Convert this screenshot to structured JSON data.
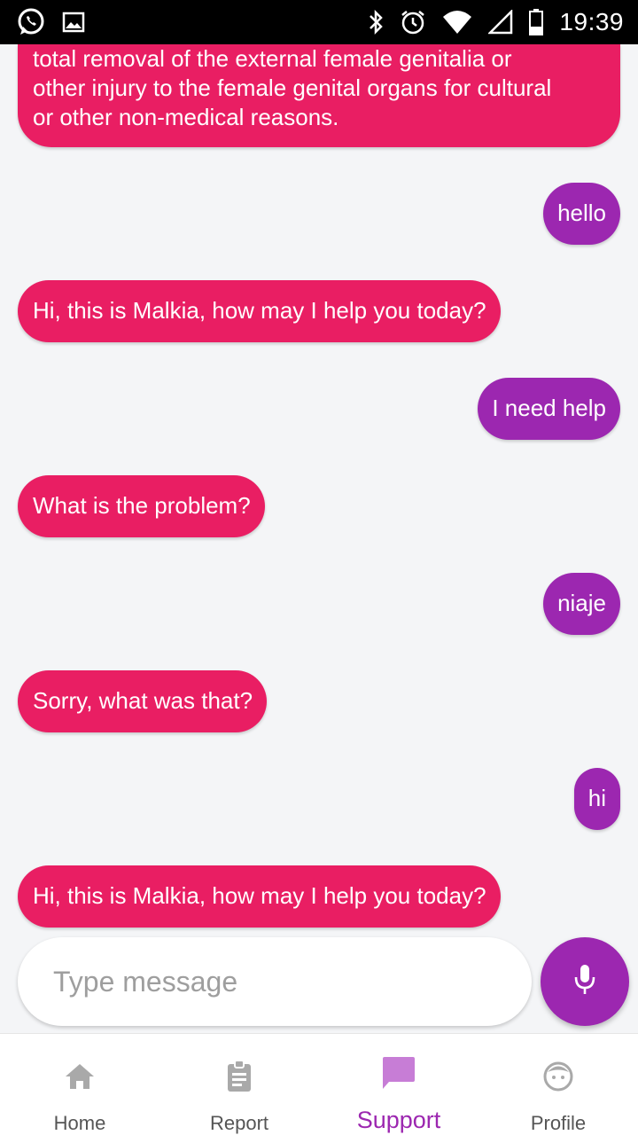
{
  "status_bar": {
    "time": "19:39",
    "icons": [
      "whatsapp-icon",
      "image-icon",
      "bluetooth-icon",
      "alarm-icon",
      "wifi-icon",
      "signal-icon",
      "battery-icon"
    ]
  },
  "chat": {
    "partial_message": {
      "lines": [
        "total removal of the external female genitalia or",
        "other injury to the female genital organs for cultural",
        "or other non-medical reasons."
      ]
    },
    "messages": [
      {
        "from": "user",
        "text": "hello"
      },
      {
        "from": "bot",
        "text": "Hi, this is Malkia, how may I help you today?"
      },
      {
        "from": "user",
        "text": "I need help"
      },
      {
        "from": "bot",
        "text": "What is the problem?"
      },
      {
        "from": "user",
        "text": "niaje"
      },
      {
        "from": "bot",
        "text": "Sorry, what was that?"
      },
      {
        "from": "user",
        "text": "hi"
      },
      {
        "from": "bot",
        "text": "Hi, this is Malkia, how may I help you today?"
      }
    ]
  },
  "input": {
    "placeholder": "Type message",
    "value": "",
    "mic_icon": "mic-icon"
  },
  "bottom_nav": {
    "items": [
      {
        "label": "Home",
        "icon": "home-icon",
        "active": false
      },
      {
        "label": "Report",
        "icon": "clipboard-icon",
        "active": false
      },
      {
        "label": "Support",
        "icon": "chat-icon",
        "active": true
      },
      {
        "label": "Profile",
        "icon": "face-icon",
        "active": false
      }
    ]
  },
  "colors": {
    "bot_bubble": "#e91e63",
    "user_bubble": "#9c27b0",
    "background": "#f4f5f7",
    "active_nav": "#9c27b0",
    "inactive_icon": "#a9a9a9"
  }
}
